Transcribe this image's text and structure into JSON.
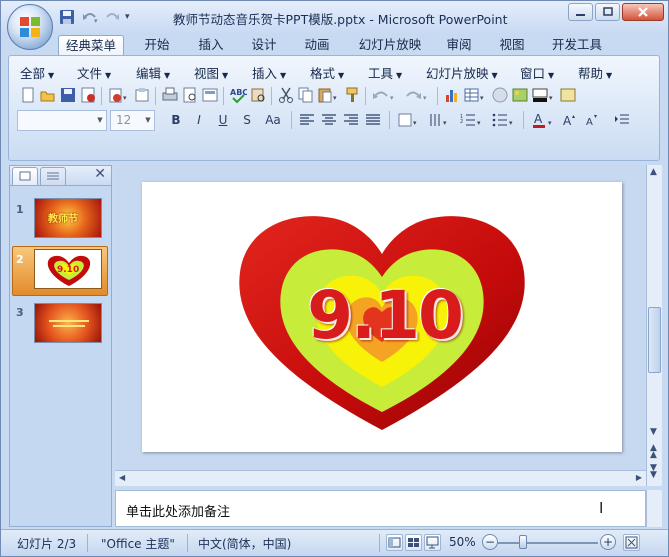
{
  "window": {
    "title": "教师节动态音乐贺卡PPT模版.pptx - Microsoft PowerPoint",
    "quick_access": [
      "save-icon",
      "undo-icon",
      "redo-icon",
      "customize-qat-icon"
    ]
  },
  "tabs": [
    {
      "label": "经典菜单",
      "active": true
    },
    {
      "label": "开始"
    },
    {
      "label": "插入"
    },
    {
      "label": "设计"
    },
    {
      "label": "动画"
    },
    {
      "label": "幻灯片放映"
    },
    {
      "label": "审阅"
    },
    {
      "label": "视图"
    },
    {
      "label": "开发工具"
    }
  ],
  "menus": [
    "全部",
    "文件",
    "编辑",
    "视图",
    "插入",
    "格式",
    "工具",
    "幻灯片放映",
    "窗口",
    "帮助"
  ],
  "toolbar": {
    "font_size": "12",
    "format_buttons": [
      "B",
      "I",
      "U",
      "S",
      "Aa"
    ]
  },
  "slides": [
    {
      "number": "1",
      "caption": "教师节"
    },
    {
      "number": "2",
      "caption": "9.10",
      "selected": true
    },
    {
      "number": "3",
      "caption": ""
    }
  ],
  "current_slide": {
    "big_text": "9.10"
  },
  "notes": {
    "placeholder": "单击此处添加备注"
  },
  "status": {
    "slide_info": "幻灯片 2/3",
    "theme": "\"Office 主题\"",
    "language": "中文(简体，中国)",
    "zoom": "50%"
  },
  "colors": {
    "heart_outer": "#c40a0a",
    "heart_mid": "#c8ec3a",
    "heart_inner": "#f7f207",
    "text_red": "#d81c1c",
    "tab_bg": "#c7daf1"
  }
}
